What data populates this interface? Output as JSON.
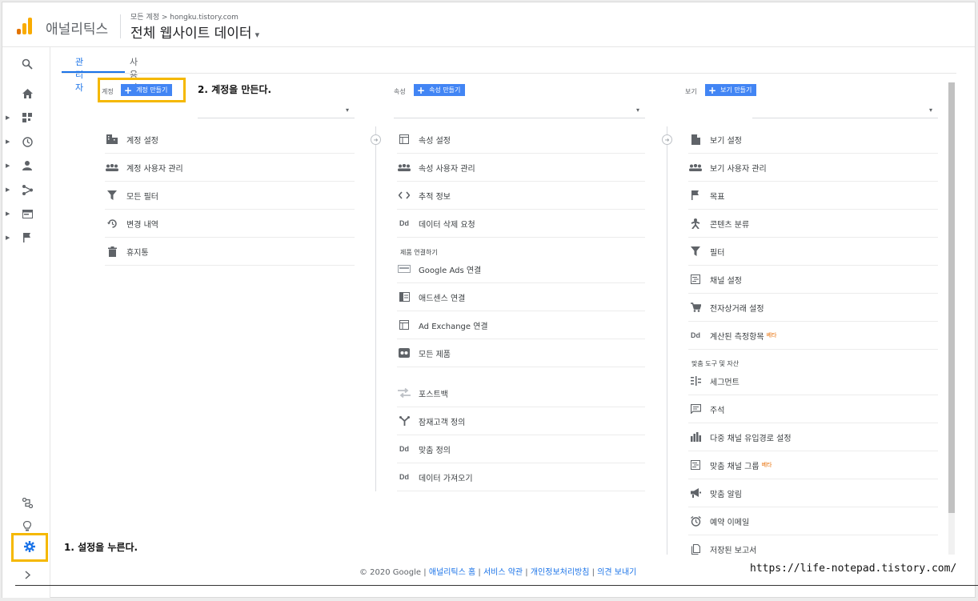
{
  "header": {
    "app_name": "애널리틱스",
    "breadcrumb": "모든 계정 > hongku.tistory.com",
    "view_title": "전체 웹사이트 데이터",
    "caret": "▾"
  },
  "tabs": [
    {
      "label": "관리자"
    },
    {
      "label": "사용자"
    }
  ],
  "account_col": {
    "header": "계정",
    "create_label": "계정 만들기",
    "items": [
      {
        "label": "계정 설정",
        "icon": "building-icon"
      },
      {
        "label": "계정 사용자 관리",
        "icon": "people-icon"
      },
      {
        "label": "모든 필터",
        "icon": "filter-icon"
      },
      {
        "label": "변경 내역",
        "icon": "history-icon"
      },
      {
        "label": "휴지통",
        "icon": "trash-icon"
      }
    ]
  },
  "property_col": {
    "header": "속성",
    "create_label": "속성 만들기",
    "items": [
      {
        "label": "속성 설정",
        "icon": "layout-icon"
      },
      {
        "label": "속성 사용자 관리",
        "icon": "people-icon"
      },
      {
        "label": "추적 정보",
        "icon": "code-icon"
      },
      {
        "label": "데이터 삭제 요청",
        "icon": "dd-icon"
      }
    ],
    "section_label": "제품 연결하기",
    "product_items": [
      {
        "label": "Google Ads 연결",
        "icon": "ads-icon"
      },
      {
        "label": "애드센스 연결",
        "icon": "adsense-icon"
      },
      {
        "label": "Ad Exchange 연결",
        "icon": "adexchange-icon"
      },
      {
        "label": "모든 제품",
        "icon": "products-icon"
      }
    ],
    "extra_items": [
      {
        "label": "포스트백",
        "icon": "postback-icon"
      },
      {
        "label": "잠재고객 정의",
        "icon": "audience-icon"
      },
      {
        "label": "맞춤 정의",
        "icon": "dd-icon"
      },
      {
        "label": "데이터 가져오기",
        "icon": "dd-icon"
      }
    ]
  },
  "view_col": {
    "header": "보기",
    "create_label": "보기 만들기",
    "items": [
      {
        "label": "보기 설정",
        "icon": "document-icon"
      },
      {
        "label": "보기 사용자 관리",
        "icon": "people-icon"
      },
      {
        "label": "목표",
        "icon": "flag-icon"
      },
      {
        "label": "콘텐츠 분류",
        "icon": "person-icon"
      },
      {
        "label": "필터",
        "icon": "filter-icon"
      },
      {
        "label": "채널 설정",
        "icon": "channel-icon"
      },
      {
        "label": "전자상거래 설정",
        "icon": "cart-icon"
      },
      {
        "label": "계산된 측정항목",
        "icon": "dd-icon",
        "badge": "베타"
      }
    ],
    "section_label": "맞춤 도구 및 자산",
    "tool_items": [
      {
        "label": "세그먼트",
        "icon": "segment-icon"
      },
      {
        "label": "주석",
        "icon": "comment-icon"
      },
      {
        "label": "다중 채널 유입경로 설정",
        "icon": "barchart-icon"
      },
      {
        "label": "맞춤 채널 그룹",
        "icon": "channel-icon",
        "badge": "베타"
      },
      {
        "label": "맞춤 알림",
        "icon": "megaphone-icon"
      },
      {
        "label": "예약 이메일",
        "icon": "alarm-icon"
      },
      {
        "label": "저장된 보고서",
        "icon": "saved-report-icon"
      }
    ]
  },
  "annotations": {
    "step1": "1. 설정을 누른다.",
    "step2": "2. 계정을 만든다."
  },
  "footer": {
    "copyright": "© 2020 Google |",
    "link1": "애널리틱스 홈",
    "link2": "서비스 약관",
    "link3": "개인정보처리방침",
    "link4": "의견 보내기"
  },
  "watermark": "https://life-notepad.tistory.com/",
  "colors": {
    "accent": "#1a73e8",
    "button": "#4285f4",
    "highlight": "#f5b800"
  }
}
